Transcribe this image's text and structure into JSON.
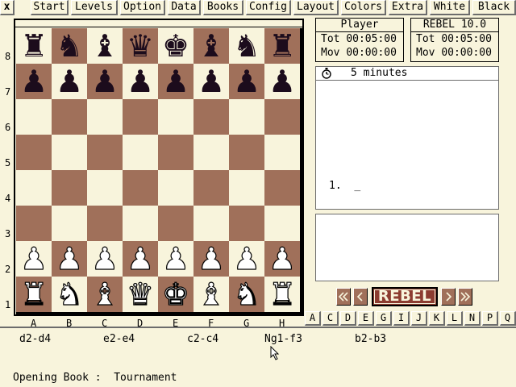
{
  "menu": {
    "close": "x",
    "items": [
      "Start",
      "Levels",
      "Option",
      "Data",
      "Books",
      "Config",
      "Layout",
      "Colors",
      "Extra",
      "White",
      "Black"
    ]
  },
  "board": {
    "rank_labels": [
      "8",
      "7",
      "6",
      "5",
      "4",
      "3",
      "2",
      "1"
    ],
    "file_labels": [
      "A",
      "B",
      "C",
      "D",
      "E",
      "F",
      "G",
      "H"
    ],
    "position": [
      [
        "bR",
        "bN",
        "bB",
        "bQ",
        "bK",
        "bB",
        "bN",
        "bR"
      ],
      [
        "bP",
        "bP",
        "bP",
        "bP",
        "bP",
        "bP",
        "bP",
        "bP"
      ],
      [
        "",
        "",
        "",
        "",
        "",
        "",
        "",
        ""
      ],
      [
        "",
        "",
        "",
        "",
        "",
        "",
        "",
        ""
      ],
      [
        "",
        "",
        "",
        "",
        "",
        "",
        "",
        ""
      ],
      [
        "",
        "",
        "",
        "",
        "",
        "",
        "",
        ""
      ],
      [
        "wP",
        "wP",
        "wP",
        "wP",
        "wP",
        "wP",
        "wP",
        "wP"
      ],
      [
        "wR",
        "wN",
        "wB",
        "wQ",
        "wK",
        "wB",
        "wN",
        "wR"
      ]
    ],
    "colors": {
      "light": "#f8f4dc",
      "dark": "#a0705a"
    }
  },
  "clocks": {
    "player": {
      "name": "Player",
      "total_label": "Tot",
      "total": "00:05:00",
      "move_label": "Mov",
      "move": "00:00:00"
    },
    "engine": {
      "name": "REBEL 10.0",
      "total_label": "Tot",
      "total": "00:05:00",
      "move_label": "Mov",
      "move": "00:00:00"
    }
  },
  "movelist": {
    "time_icon": "stopwatch-icon",
    "time_control": "5 minutes",
    "move_number": "1.",
    "move_cursor": "_"
  },
  "nav": {
    "first": "⏮",
    "back": "◀",
    "logo": "REBEL",
    "forward": "▶",
    "last": "⏭",
    "accent": "#8c3c30"
  },
  "letters": [
    "A",
    "C",
    "D",
    "E",
    "G",
    "I",
    "J",
    "K",
    "L",
    "N",
    "P",
    "Q"
  ],
  "book": {
    "moves": [
      "d2-d4",
      "e2-e4",
      "c2-c4",
      "Ng1-f3",
      "b2-b3"
    ],
    "status_label": "Opening Book :",
    "status_value": "Tournament"
  }
}
